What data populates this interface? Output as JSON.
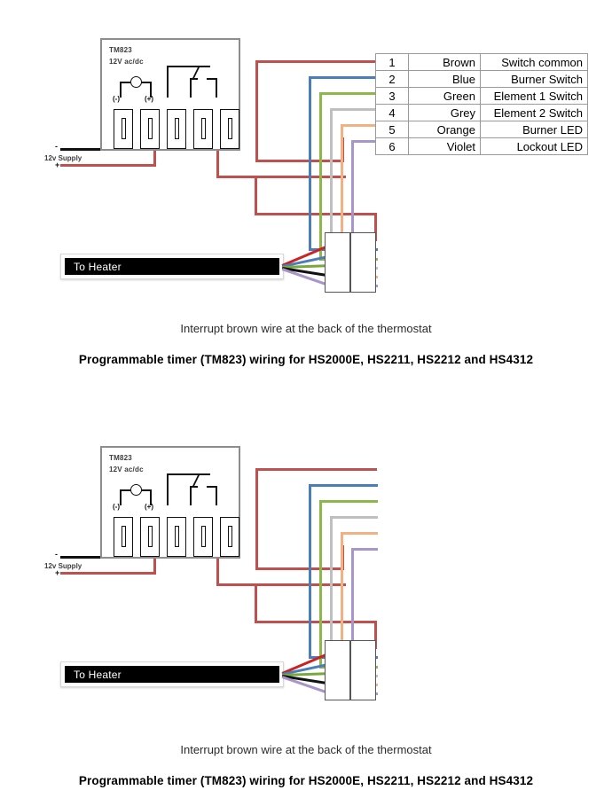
{
  "colors": {
    "brown": "#b5524a",
    "blue": "#4a7ebb",
    "green": "#8cb84a",
    "grey": "#bfbfbf",
    "orange": "#f2b183",
    "violet": "#a895c9",
    "black": "#111111",
    "red": "#c0504d",
    "box_border": "#8d8d8d",
    "table_border": "#9a9a9a"
  },
  "diagrams": [
    {
      "id": "diagram-1",
      "timer": {
        "title": "TM823",
        "subtitle": "12V ac/dc",
        "negative_label": "(-)",
        "positive_label": "(+)"
      },
      "supply": {
        "label": "12v Supply",
        "negative_sign": "-",
        "positive_sign": "+"
      },
      "heater": {
        "label": "To Heater"
      },
      "table": {
        "show": true,
        "rows": [
          {
            "number": "1",
            "color": "Brown",
            "function": "Switch common",
            "swatch": "#b5524a"
          },
          {
            "number": "2",
            "color": "Blue",
            "function": "Burner Switch",
            "swatch": "#4a7ebb"
          },
          {
            "number": "3",
            "color": "Green",
            "function": "Element 1 Switch",
            "swatch": "#8cb84a"
          },
          {
            "number": "4",
            "color": "Grey",
            "function": "Element 2 Switch",
            "swatch": "#bfbfbf"
          },
          {
            "number": "5",
            "color": "Orange",
            "function": "Burner LED",
            "swatch": "#f2b183"
          },
          {
            "number": "6",
            "color": "Violet",
            "function": "Lockout LED",
            "swatch": "#a895c9"
          }
        ]
      },
      "caption_sub": "Interrupt brown wire at the back of the thermostat",
      "caption_main": "Programmable timer (TM823) wiring for HS2000E, HS2211, HS2212 and HS4312"
    },
    {
      "id": "diagram-2",
      "timer": {
        "title": "TM823",
        "subtitle": "12V ac/dc",
        "negative_label": "(-)",
        "positive_label": "(+)"
      },
      "supply": {
        "label": "12v Supply",
        "negative_sign": "-",
        "positive_sign": "+"
      },
      "heater": {
        "label": "To Heater"
      },
      "table": {
        "show": false,
        "rows": []
      },
      "caption_sub": "Interrupt brown wire at the back of the thermostat",
      "caption_main": "Programmable timer (TM823) wiring for HS2000E, HS2211, HS2212 and HS4312"
    }
  ]
}
